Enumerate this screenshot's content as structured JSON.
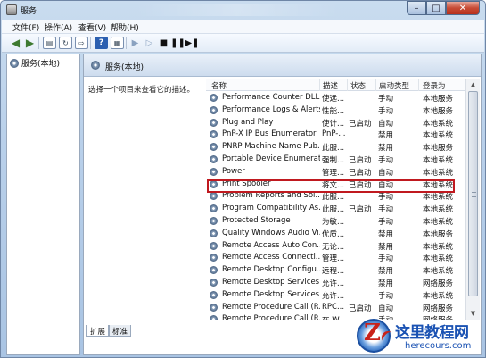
{
  "window": {
    "title": "服务",
    "controls": {
      "minimize": "–",
      "maximize": "□",
      "close": "✕"
    }
  },
  "menu": [
    "文件(F)",
    "操作(A)",
    "查看(V)",
    "帮助(H)"
  ],
  "toolbar": {
    "back_icon": "back-arrow-icon",
    "forward_icon": "forward-arrow-icon",
    "start_icon": "play-icon",
    "stop_icon": "stop-icon",
    "pause_icon": "pause-icon",
    "restart_icon": "restart-icon"
  },
  "tree": {
    "root": "服务(本地)"
  },
  "panel": {
    "header": "服务(本地)",
    "description": "选择一个项目来查看它的描述。"
  },
  "columns": [
    "名称",
    "描述",
    "状态",
    "启动类型",
    "登录为"
  ],
  "services": [
    {
      "name": "Performance Counter DLL...",
      "desc": "使远...",
      "status": "",
      "startup": "手动",
      "logon": "本地服务"
    },
    {
      "name": "Performance Logs & Alerts",
      "desc": "性能...",
      "status": "",
      "startup": "手动",
      "logon": "本地服务"
    },
    {
      "name": "Plug and Play",
      "desc": "使计...",
      "status": "已启动",
      "startup": "自动",
      "logon": "本地系统"
    },
    {
      "name": "PnP-X IP Bus Enumerator",
      "desc": "PnP-...",
      "status": "",
      "startup": "禁用",
      "logon": "本地系统"
    },
    {
      "name": "PNRP Machine Name Pub...",
      "desc": "此服...",
      "status": "",
      "startup": "禁用",
      "logon": "本地服务"
    },
    {
      "name": "Portable Device Enumerat...",
      "desc": "强制...",
      "status": "已启动",
      "startup": "手动",
      "logon": "本地系统"
    },
    {
      "name": "Power",
      "desc": "管理...",
      "status": "已启动",
      "startup": "自动",
      "logon": "本地系统"
    },
    {
      "name": "Print Spooler",
      "desc": "将文...",
      "status": "已启动",
      "startup": "自动",
      "logon": "本地系统"
    },
    {
      "name": "Problem Reports and Sol...",
      "desc": "此服...",
      "status": "",
      "startup": "手动",
      "logon": "本地系统"
    },
    {
      "name": "Program Compatibility As...",
      "desc": "此服...",
      "status": "已启动",
      "startup": "手动",
      "logon": "本地系统"
    },
    {
      "name": "Protected Storage",
      "desc": "为敏...",
      "status": "",
      "startup": "手动",
      "logon": "本地系统"
    },
    {
      "name": "Quality Windows Audio Vi...",
      "desc": "优质...",
      "status": "",
      "startup": "禁用",
      "logon": "本地服务"
    },
    {
      "name": "Remote Access Auto Con...",
      "desc": "无论...",
      "status": "",
      "startup": "禁用",
      "logon": "本地系统"
    },
    {
      "name": "Remote Access Connecti...",
      "desc": "管理...",
      "status": "",
      "startup": "手动",
      "logon": "本地系统"
    },
    {
      "name": "Remote Desktop Configu...",
      "desc": "远程...",
      "status": "",
      "startup": "禁用",
      "logon": "本地系统"
    },
    {
      "name": "Remote Desktop Services",
      "desc": "允许...",
      "status": "",
      "startup": "禁用",
      "logon": "网络服务"
    },
    {
      "name": "Remote Desktop Services...",
      "desc": "允许...",
      "status": "",
      "startup": "手动",
      "logon": "本地系统"
    },
    {
      "name": "Remote Procedure Call (R...",
      "desc": "RPC...",
      "status": "已启动",
      "startup": "自动",
      "logon": "网络服务"
    },
    {
      "name": "Remote Procedure Call (R...",
      "desc": "在 W...",
      "status": "",
      "startup": "手动",
      "logon": "网络服务"
    }
  ],
  "tabs": [
    "扩展",
    "标准"
  ],
  "scrollbar": {
    "up": "▲",
    "down": "▼"
  },
  "watermark": {
    "cn": "这里教程网",
    "url": "herecours.com"
  },
  "colors": {
    "highlight": "#c0191f",
    "accent": "#1a52b3"
  }
}
